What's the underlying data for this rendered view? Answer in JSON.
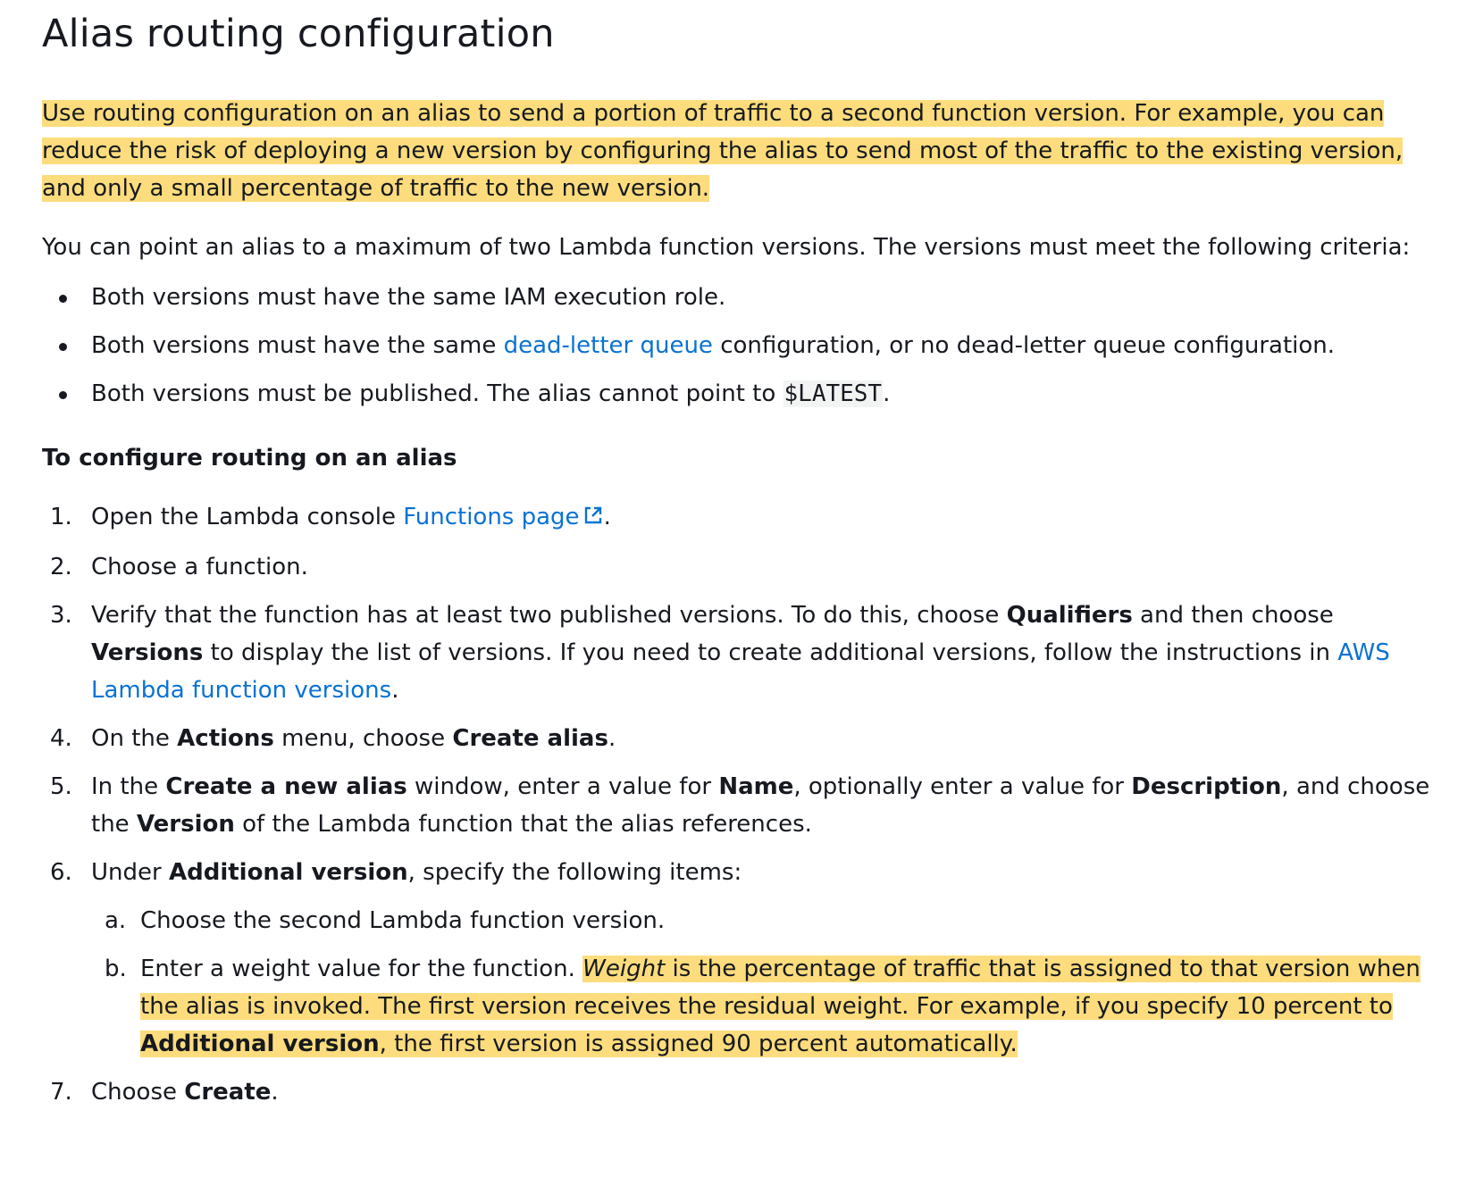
{
  "title": "Alias routing configuration",
  "intro": "Use routing configuration on an alias to send a portion of traffic to a second function version. For example, you can reduce the risk of deploying a new version by configuring the alias to send most of the traffic to the existing version, and only a small percentage of traffic to the new version.",
  "criteria_text": "You can point an alias to a maximum of two Lambda function versions. The versions must meet the following criteria:",
  "bullets": {
    "b1": "Both versions must have the same IAM execution role.",
    "b2_pre": "Both versions must have the same ",
    "b2_link": "dead-letter queue",
    "b2_post": " configuration, or no dead-letter queue configuration.",
    "b3_pre": "Both versions must be published. The alias cannot point to ",
    "b3_code": "$LATEST",
    "b3_post": "."
  },
  "procedure_title": "To configure routing on an alias",
  "steps": {
    "s1": {
      "num": "1.",
      "pre": "Open the Lambda console ",
      "link": "Functions page",
      "post": "."
    },
    "s2": {
      "num": "2.",
      "text": "Choose a function."
    },
    "s3": {
      "num": "3.",
      "t1": "Verify that the function has at least two published versions. To do this, choose ",
      "b1": "Qualifiers",
      "t2": " and then choose ",
      "b2": "Versions",
      "t3": " to display the list of versions. If you need to create additional versions, follow the instructions in ",
      "link": "AWS Lambda function versions",
      "t4": "."
    },
    "s4": {
      "num": "4.",
      "t1": "On the ",
      "b1": "Actions",
      "t2": " menu, choose ",
      "b2": "Create alias",
      "t3": "."
    },
    "s5": {
      "num": "5.",
      "t1": "In the ",
      "b1": "Create a new alias",
      "t2": " window, enter a value for ",
      "b2": "Name",
      "t3": ", optionally enter a value for ",
      "b3": "Description",
      "t4": ", and choose the ",
      "b4": "Version",
      "t5": " of the Lambda function that the alias references."
    },
    "s6": {
      "num": "6.",
      "t1": "Under ",
      "b1": "Additional version",
      "t2": ", specify the following items:",
      "sub_a": {
        "num": "a.",
        "text": "Choose the second Lambda function version."
      },
      "sub_b": {
        "num": "b.",
        "t1": "Enter a weight value for the function. ",
        "i1": "Weight",
        "t2": " is the percentage of traffic that is assigned to that version when the alias is invoked. The first version receives the residual weight. For example, if you specify 10 percent to ",
        "b1": "Additional version",
        "t3": ", the first version is assigned 90 percent automatically."
      }
    },
    "s7": {
      "num": "7.",
      "t1": "Choose ",
      "b1": "Create",
      "t2": "."
    }
  },
  "colors": {
    "highlight": "#fcdc7c",
    "link": "#0972d3",
    "text": "#16191f"
  },
  "icons": {
    "external_link": "external-link-icon"
  }
}
